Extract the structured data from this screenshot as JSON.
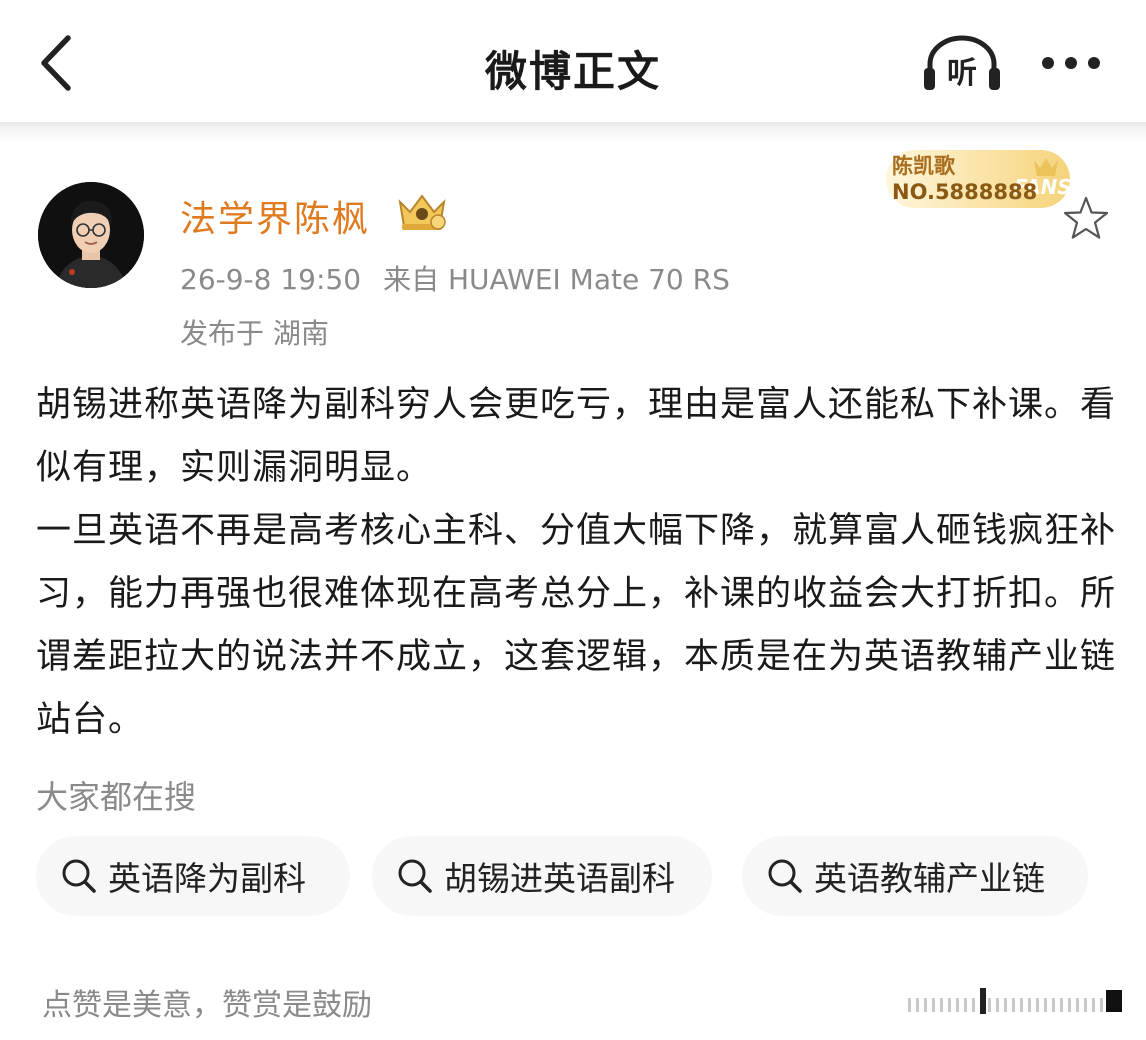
{
  "header": {
    "title": "微博正文",
    "back_icon": "chevron-left-icon",
    "listen_label": "听",
    "more_icon": "more-dots-icon"
  },
  "author": {
    "name": "法学界陈枫",
    "time": "26-9-8 19:50",
    "source": "来自 HUAWEI Mate 70 RS",
    "location": "发布于 湖南",
    "fans_badge": {
      "name": "陈凯歌",
      "number": "NO.5888888",
      "tag": "FANS"
    }
  },
  "post": {
    "paragraph1": "胡锡进称英语降为副科穷人会更吃亏，理由是富人还能私下补课。看似有理，实则漏洞明显。",
    "paragraph2": "一旦英语不再是高考核心主科、分值大幅下降，就算富人砸钱疯狂补习，能力再强也很难体现在高考总分上，补课的收益会大打折扣。所谓差距拉大的说法并不成立，这套逻辑，本质是在为英语教辅产业链站台。"
  },
  "hot_search": {
    "label": "大家都在搜",
    "chips": [
      "英语降为副科",
      "胡锡进英语副科",
      "英语教辅产业链"
    ]
  },
  "footer": {
    "text": "点赞是美意，赞赏是鼓励"
  },
  "colors": {
    "username": "#e07a1f",
    "meta": "#8a8a8a",
    "chip_bg": "#f7f7f7",
    "badge": "#f5d37a"
  }
}
